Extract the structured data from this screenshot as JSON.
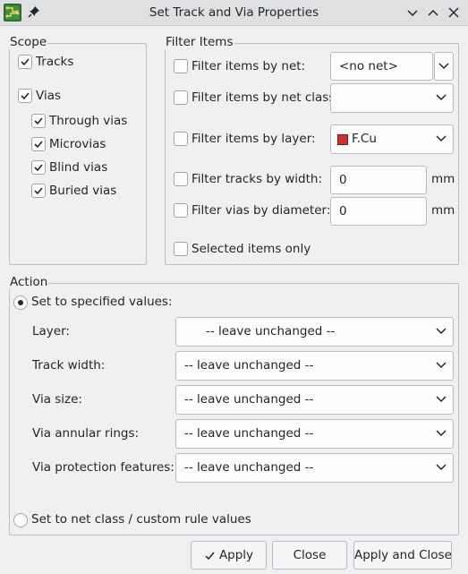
{
  "window": {
    "title": "Set Track and Via Properties",
    "app_icon": "pcb-board-icon",
    "pin_icon": "pin-icon",
    "controls": [
      "minimize-icon",
      "maximize-icon",
      "close-icon"
    ]
  },
  "scope": {
    "label": "Scope",
    "tracks": {
      "label": "Tracks",
      "checked": true
    },
    "vias": {
      "label": "Vias",
      "checked": true
    },
    "through_vias": {
      "label": "Through vias",
      "checked": true
    },
    "microvias": {
      "label": "Microvias",
      "checked": true
    },
    "blind_vias": {
      "label": "Blind vias",
      "checked": true
    },
    "buried_vias": {
      "label": "Buried vias",
      "checked": true
    }
  },
  "filter": {
    "label": "Filter Items",
    "by_net": {
      "label": "Filter items by net:",
      "checked": false,
      "value": "<no net>"
    },
    "by_net_class": {
      "label": "Filter items by net class:",
      "checked": false,
      "value": ""
    },
    "by_layer": {
      "label": "Filter items by layer:",
      "checked": false,
      "value": "F.Cu",
      "swatch_color": "#c83434"
    },
    "track_width": {
      "label": "Filter tracks by width:",
      "checked": false,
      "value": "0",
      "unit": "mm"
    },
    "via_diameter": {
      "label": "Filter vias by diameter:",
      "checked": false,
      "value": "0",
      "unit": "mm"
    },
    "selected_only": {
      "label": "Selected items only",
      "checked": false
    }
  },
  "action": {
    "label": "Action",
    "set_specified": {
      "label": "Set to specified values:",
      "selected": true
    },
    "layer": {
      "label": "Layer:",
      "value": "-- leave unchanged --"
    },
    "track_width": {
      "label": "Track width:",
      "value": "-- leave unchanged --"
    },
    "via_size": {
      "label": "Via size:",
      "value": "-- leave unchanged --"
    },
    "via_annular_rings": {
      "label": "Via annular rings:",
      "value": "-- leave unchanged --"
    },
    "via_protection": {
      "label": "Via protection features:",
      "value": "-- leave unchanged --"
    },
    "set_netclass": {
      "label": "Set to net class / custom rule values",
      "selected": false
    }
  },
  "buttons": {
    "apply": "Apply",
    "close": "Close",
    "apply_close": "Apply and Close"
  }
}
